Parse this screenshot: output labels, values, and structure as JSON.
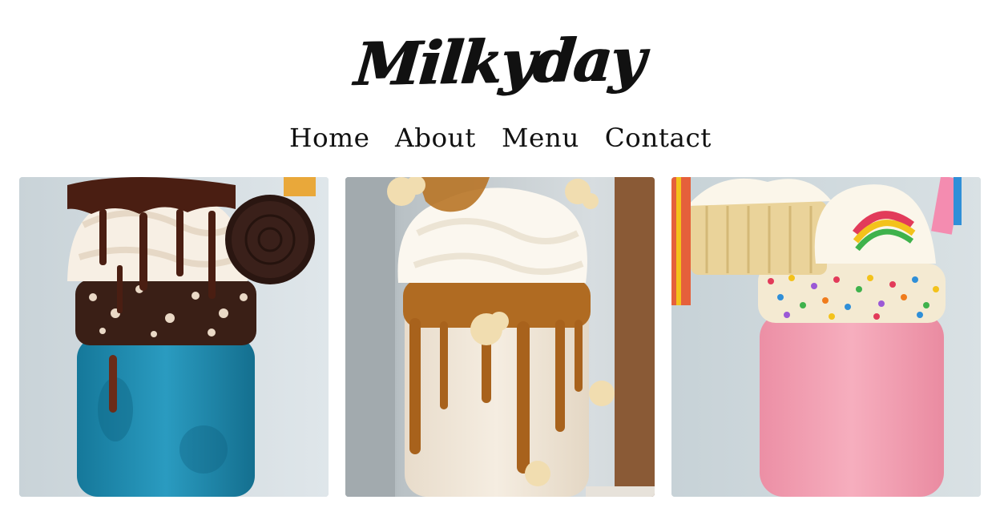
{
  "header": {
    "logo_text": "Milkyday"
  },
  "nav": {
    "items": [
      {
        "label": "Home"
      },
      {
        "label": "About"
      },
      {
        "label": "Menu"
      },
      {
        "label": "Contact"
      }
    ]
  },
  "gallery": {
    "photos": [
      {
        "subject": "cookies-and-cream-freakshake",
        "accent": "#1e8fb3"
      },
      {
        "subject": "caramel-popcorn-freakshake",
        "accent": "#b7742a"
      },
      {
        "subject": "rainbow-sprinkle-freakshake",
        "accent": "#f2a2b6"
      }
    ]
  },
  "colors": {
    "background": "#ffffff",
    "text": "#111111"
  }
}
